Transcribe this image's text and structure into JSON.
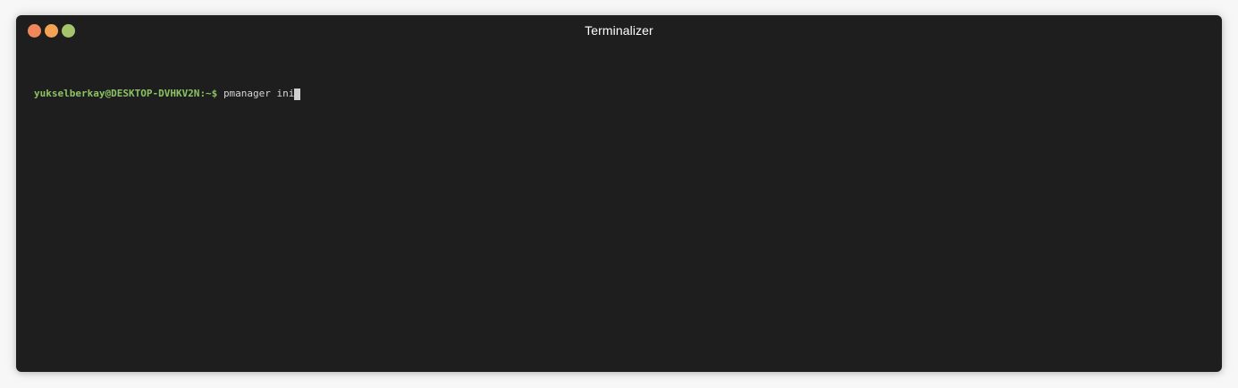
{
  "window": {
    "title": "Terminalizer",
    "controls": [
      {
        "name": "close",
        "color": "#f0875a"
      },
      {
        "name": "minimize",
        "color": "#f2a454"
      },
      {
        "name": "zoom",
        "color": "#a4c56c"
      }
    ]
  },
  "terminal": {
    "prompt_user": "yukselberkay@DESKTOP-DVHKV2N",
    "prompt_suffix": ":~$ ",
    "command": "pmanager ini",
    "colors": {
      "background": "#1e1e1e",
      "prompt": "#8cc265",
      "text": "#d6d6d6",
      "cursor": "#d0d0d0"
    }
  }
}
